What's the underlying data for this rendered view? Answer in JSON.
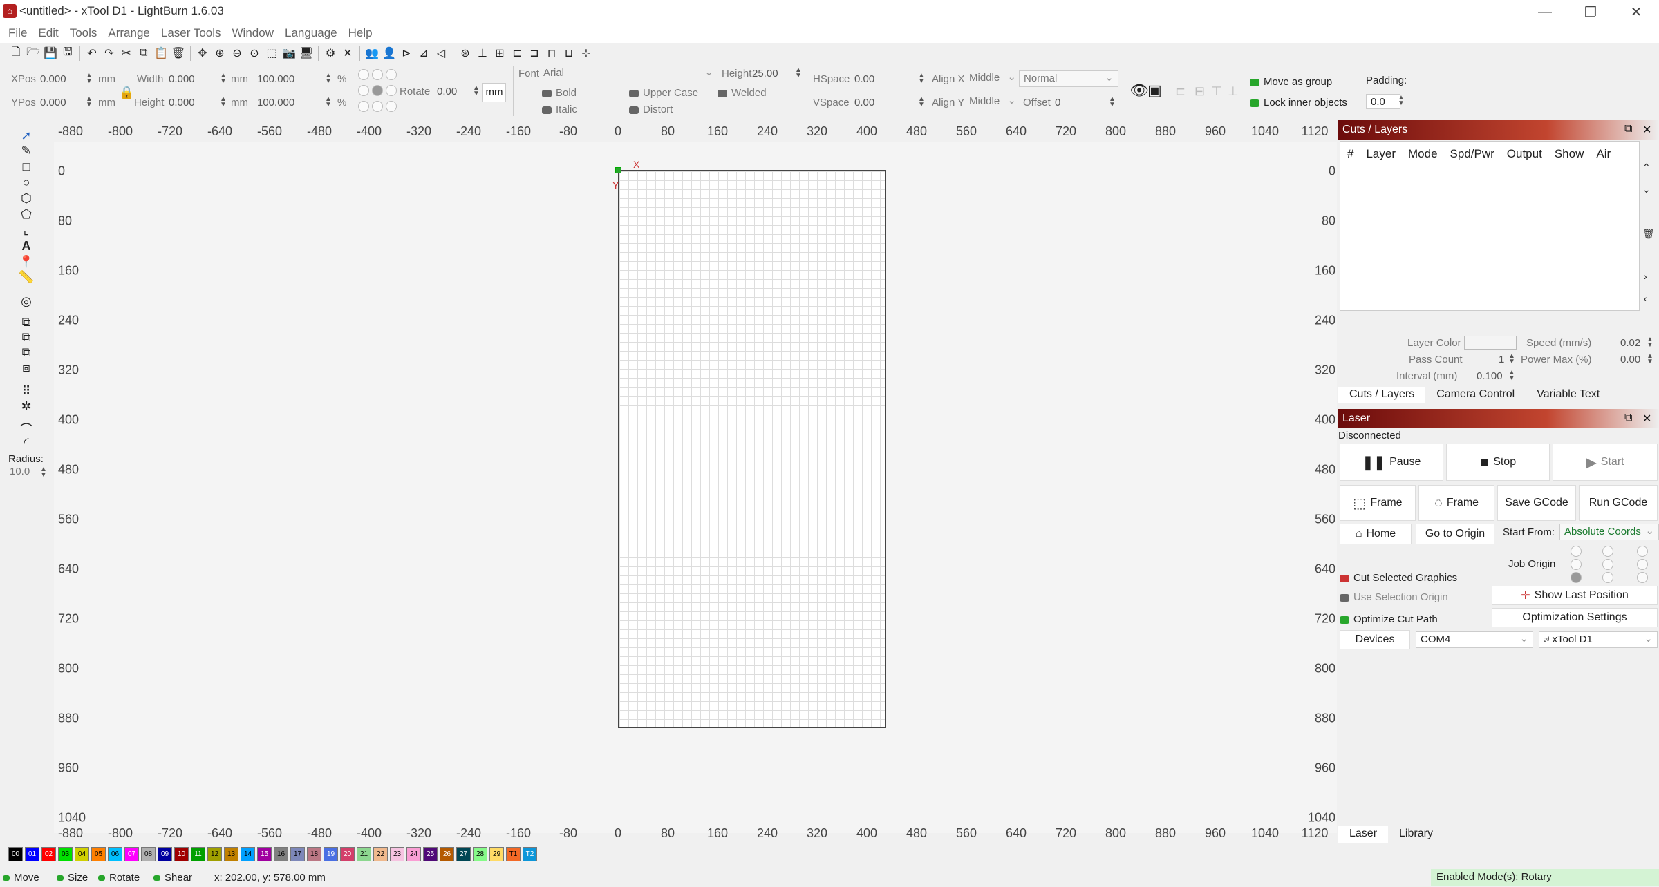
{
  "window": {
    "title": "<untitled> - xTool D1 - LightBurn 1.6.03",
    "minimize": "—",
    "maximize": "❐",
    "close": "✕"
  },
  "menu": [
    "File",
    "Edit",
    "Tools",
    "Arrange",
    "Laser Tools",
    "Window",
    "Language",
    "Help"
  ],
  "props": {
    "xpos_label": "XPos",
    "xpos": "0.000",
    "ypos_label": "YPos",
    "ypos": "0.000",
    "unit_mm": "mm",
    "width_label": "Width",
    "width": "0.000",
    "height_label": "Height",
    "height": "0.000",
    "scale_w": "100.000",
    "scale_h": "100.000",
    "pct": "%",
    "rotate_label": "Rotate",
    "rotate": "0.00",
    "mm_toggle": "mm",
    "font_label": "Font",
    "font": "Arial",
    "text_height_label": "Height",
    "text_height": "25.00",
    "bold": "Bold",
    "italic": "Italic",
    "upper": "Upper Case",
    "distort": "Distort",
    "welded": "Welded",
    "hspace_label": "HSpace",
    "hspace": "0.00",
    "vspace_label": "VSpace",
    "vspace": "0.00",
    "alignx_label": "Align X",
    "alignx": "Middle",
    "aligny_label": "Align Y",
    "aligny": "Middle",
    "mode": "Normal",
    "offset_label": "Offset",
    "offset": "0",
    "move_group": "Move as group",
    "lock_inner": "Lock inner objects",
    "padding_label": "Padding:",
    "padding": "0.0"
  },
  "left_tools": {
    "radius_label": "Radius:",
    "radius": "10.0"
  },
  "ruler": {
    "x_ticks": [
      "-880",
      "-800",
      "-720",
      "-640",
      "-560",
      "-480",
      "-400",
      "-320",
      "-240",
      "-160",
      "-80",
      "0",
      "80",
      "160",
      "240",
      "320",
      "400",
      "480",
      "560",
      "640",
      "720",
      "800",
      "880",
      "960",
      "1040",
      "1120"
    ],
    "y_ticks": [
      "0",
      "80",
      "160",
      "240",
      "320",
      "400",
      "480",
      "560",
      "640",
      "720",
      "800",
      "880",
      "960",
      "1040"
    ],
    "axis_x": "X",
    "axis_y": "Y"
  },
  "cuts": {
    "title": "Cuts / Layers",
    "columns": [
      "#",
      "Layer",
      "Mode",
      "Spd/Pwr",
      "Output",
      "Show",
      "Air"
    ],
    "layer_color": "Layer Color",
    "speed_label": "Speed (mm/s)",
    "speed": "0.02",
    "pass_label": "Pass Count",
    "pass": "1",
    "power_label": "Power Max (%)",
    "power": "0.00",
    "interval_label": "Interval (mm)",
    "interval": "0.100",
    "tabs": [
      "Cuts / Layers",
      "Camera Control",
      "Variable Text"
    ]
  },
  "laser": {
    "title": "Laser",
    "status": "Disconnected",
    "pause": "Pause",
    "stop": "Stop",
    "start": "Start",
    "frame1": "Frame",
    "frame2": "Frame",
    "save_gcode": "Save GCode",
    "run_gcode": "Run GCode",
    "home": "Home",
    "go_origin": "Go to Origin",
    "start_from_label": "Start From:",
    "start_from": "Absolute Coords",
    "job_origin": "Job Origin",
    "cut_selected": "Cut Selected Graphics",
    "use_selection": "Use Selection Origin",
    "show_last": "Show Last Position",
    "optimize": "Optimize Cut Path",
    "opt_settings": "Optimization Settings",
    "devices": "Devices",
    "port": "COM4",
    "device": "xTool D1",
    "tabs": [
      "Laser",
      "Library"
    ]
  },
  "palette": [
    {
      "label": "00",
      "color": "#000000",
      "fg": "#ffffff"
    },
    {
      "label": "01",
      "color": "#0000ff",
      "fg": "#ffffff"
    },
    {
      "label": "02",
      "color": "#ff0000",
      "fg": "#ffffff"
    },
    {
      "label": "03",
      "color": "#00e000",
      "fg": "#000000"
    },
    {
      "label": "04",
      "color": "#d0d000",
      "fg": "#000000"
    },
    {
      "label": "05",
      "color": "#ff8000",
      "fg": "#000000"
    },
    {
      "label": "06",
      "color": "#00c0ff",
      "fg": "#000000"
    },
    {
      "label": "07",
      "color": "#ff00ff",
      "fg": "#ffffff"
    },
    {
      "label": "08",
      "color": "#b0b0b0",
      "fg": "#000000"
    },
    {
      "label": "09",
      "color": "#0000a0",
      "fg": "#ffffff"
    },
    {
      "label": "10",
      "color": "#a00000",
      "fg": "#ffffff"
    },
    {
      "label": "11",
      "color": "#00a000",
      "fg": "#ffffff"
    },
    {
      "label": "12",
      "color": "#a0a000",
      "fg": "#000000"
    },
    {
      "label": "13",
      "color": "#c08000",
      "fg": "#000000"
    },
    {
      "label": "14",
      "color": "#00a0ff",
      "fg": "#000000"
    },
    {
      "label": "15",
      "color": "#a000a0",
      "fg": "#ffffff"
    },
    {
      "label": "16",
      "color": "#808080",
      "fg": "#000000"
    },
    {
      "label": "17",
      "color": "#7d87b9",
      "fg": "#000000"
    },
    {
      "label": "18",
      "color": "#bb7784",
      "fg": "#000000"
    },
    {
      "label": "19",
      "color": "#4a6fe3",
      "fg": "#ffffff"
    },
    {
      "label": "20",
      "color": "#d33f6a",
      "fg": "#ffffff"
    },
    {
      "label": "21",
      "color": "#8cd78f",
      "fg": "#000000"
    },
    {
      "label": "22",
      "color": "#f0b98d",
      "fg": "#000000"
    },
    {
      "label": "23",
      "color": "#f6c4e1",
      "fg": "#000000"
    },
    {
      "label": "24",
      "color": "#fa9ed4",
      "fg": "#000000"
    },
    {
      "label": "25",
      "color": "#500a78",
      "fg": "#ffffff"
    },
    {
      "label": "26",
      "color": "#b45a00",
      "fg": "#ffffff"
    },
    {
      "label": "27",
      "color": "#004754",
      "fg": "#ffffff"
    },
    {
      "label": "28",
      "color": "#86fa88",
      "fg": "#000000"
    },
    {
      "label": "29",
      "color": "#ffdb66",
      "fg": "#000000"
    },
    {
      "label": "T1",
      "color": "#f36926",
      "fg": "#000000"
    },
    {
      "label": "T2",
      "color": "#0c96d9",
      "fg": "#ffffff"
    }
  ],
  "status": {
    "move": "Move",
    "size": "Size",
    "rotate": "Rotate",
    "shear": "Shear",
    "coords": "x: 202.00, y: 578.00 mm",
    "modes": "Enabled Mode(s): Rotary"
  },
  "colors": {
    "accent_green": "#27a62b",
    "header_dark": "#6b0b0b",
    "header_red": "#c2452f"
  }
}
